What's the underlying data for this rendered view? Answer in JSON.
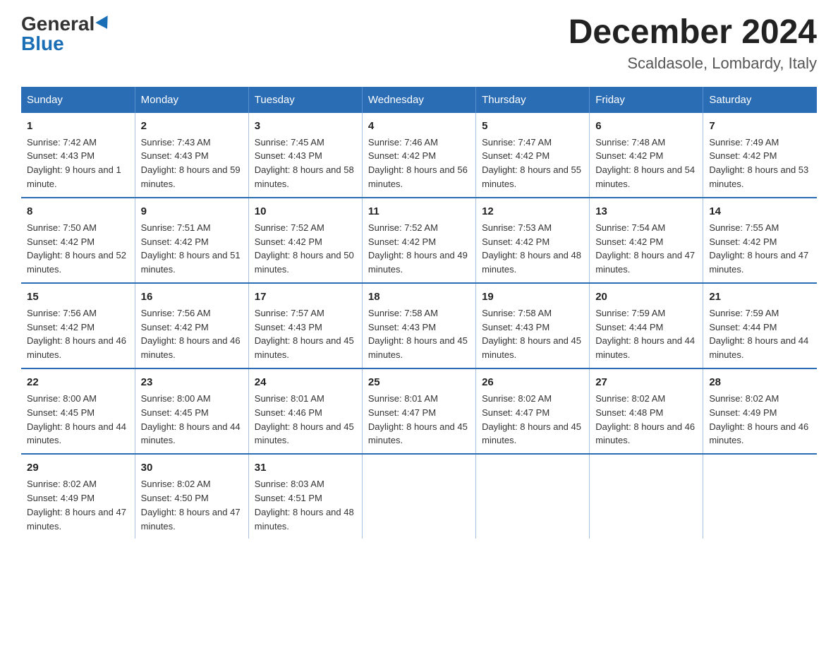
{
  "header": {
    "logo_general": "General",
    "logo_blue": "Blue",
    "month_title": "December 2024",
    "location": "Scaldasole, Lombardy, Italy"
  },
  "days_of_week": [
    "Sunday",
    "Monday",
    "Tuesday",
    "Wednesday",
    "Thursday",
    "Friday",
    "Saturday"
  ],
  "weeks": [
    [
      {
        "day": "1",
        "sunrise": "7:42 AM",
        "sunset": "4:43 PM",
        "daylight": "9 hours and 1 minute."
      },
      {
        "day": "2",
        "sunrise": "7:43 AM",
        "sunset": "4:43 PM",
        "daylight": "8 hours and 59 minutes."
      },
      {
        "day": "3",
        "sunrise": "7:45 AM",
        "sunset": "4:43 PM",
        "daylight": "8 hours and 58 minutes."
      },
      {
        "day": "4",
        "sunrise": "7:46 AM",
        "sunset": "4:42 PM",
        "daylight": "8 hours and 56 minutes."
      },
      {
        "day": "5",
        "sunrise": "7:47 AM",
        "sunset": "4:42 PM",
        "daylight": "8 hours and 55 minutes."
      },
      {
        "day": "6",
        "sunrise": "7:48 AM",
        "sunset": "4:42 PM",
        "daylight": "8 hours and 54 minutes."
      },
      {
        "day": "7",
        "sunrise": "7:49 AM",
        "sunset": "4:42 PM",
        "daylight": "8 hours and 53 minutes."
      }
    ],
    [
      {
        "day": "8",
        "sunrise": "7:50 AM",
        "sunset": "4:42 PM",
        "daylight": "8 hours and 52 minutes."
      },
      {
        "day": "9",
        "sunrise": "7:51 AM",
        "sunset": "4:42 PM",
        "daylight": "8 hours and 51 minutes."
      },
      {
        "day": "10",
        "sunrise": "7:52 AM",
        "sunset": "4:42 PM",
        "daylight": "8 hours and 50 minutes."
      },
      {
        "day": "11",
        "sunrise": "7:52 AM",
        "sunset": "4:42 PM",
        "daylight": "8 hours and 49 minutes."
      },
      {
        "day": "12",
        "sunrise": "7:53 AM",
        "sunset": "4:42 PM",
        "daylight": "8 hours and 48 minutes."
      },
      {
        "day": "13",
        "sunrise": "7:54 AM",
        "sunset": "4:42 PM",
        "daylight": "8 hours and 47 minutes."
      },
      {
        "day": "14",
        "sunrise": "7:55 AM",
        "sunset": "4:42 PM",
        "daylight": "8 hours and 47 minutes."
      }
    ],
    [
      {
        "day": "15",
        "sunrise": "7:56 AM",
        "sunset": "4:42 PM",
        "daylight": "8 hours and 46 minutes."
      },
      {
        "day": "16",
        "sunrise": "7:56 AM",
        "sunset": "4:42 PM",
        "daylight": "8 hours and 46 minutes."
      },
      {
        "day": "17",
        "sunrise": "7:57 AM",
        "sunset": "4:43 PM",
        "daylight": "8 hours and 45 minutes."
      },
      {
        "day": "18",
        "sunrise": "7:58 AM",
        "sunset": "4:43 PM",
        "daylight": "8 hours and 45 minutes."
      },
      {
        "day": "19",
        "sunrise": "7:58 AM",
        "sunset": "4:43 PM",
        "daylight": "8 hours and 45 minutes."
      },
      {
        "day": "20",
        "sunrise": "7:59 AM",
        "sunset": "4:44 PM",
        "daylight": "8 hours and 44 minutes."
      },
      {
        "day": "21",
        "sunrise": "7:59 AM",
        "sunset": "4:44 PM",
        "daylight": "8 hours and 44 minutes."
      }
    ],
    [
      {
        "day": "22",
        "sunrise": "8:00 AM",
        "sunset": "4:45 PM",
        "daylight": "8 hours and 44 minutes."
      },
      {
        "day": "23",
        "sunrise": "8:00 AM",
        "sunset": "4:45 PM",
        "daylight": "8 hours and 44 minutes."
      },
      {
        "day": "24",
        "sunrise": "8:01 AM",
        "sunset": "4:46 PM",
        "daylight": "8 hours and 45 minutes."
      },
      {
        "day": "25",
        "sunrise": "8:01 AM",
        "sunset": "4:47 PM",
        "daylight": "8 hours and 45 minutes."
      },
      {
        "day": "26",
        "sunrise": "8:02 AM",
        "sunset": "4:47 PM",
        "daylight": "8 hours and 45 minutes."
      },
      {
        "day": "27",
        "sunrise": "8:02 AM",
        "sunset": "4:48 PM",
        "daylight": "8 hours and 46 minutes."
      },
      {
        "day": "28",
        "sunrise": "8:02 AM",
        "sunset": "4:49 PM",
        "daylight": "8 hours and 46 minutes."
      }
    ],
    [
      {
        "day": "29",
        "sunrise": "8:02 AM",
        "sunset": "4:49 PM",
        "daylight": "8 hours and 47 minutes."
      },
      {
        "day": "30",
        "sunrise": "8:02 AM",
        "sunset": "4:50 PM",
        "daylight": "8 hours and 47 minutes."
      },
      {
        "day": "31",
        "sunrise": "8:03 AM",
        "sunset": "4:51 PM",
        "daylight": "8 hours and 48 minutes."
      },
      null,
      null,
      null,
      null
    ]
  ]
}
